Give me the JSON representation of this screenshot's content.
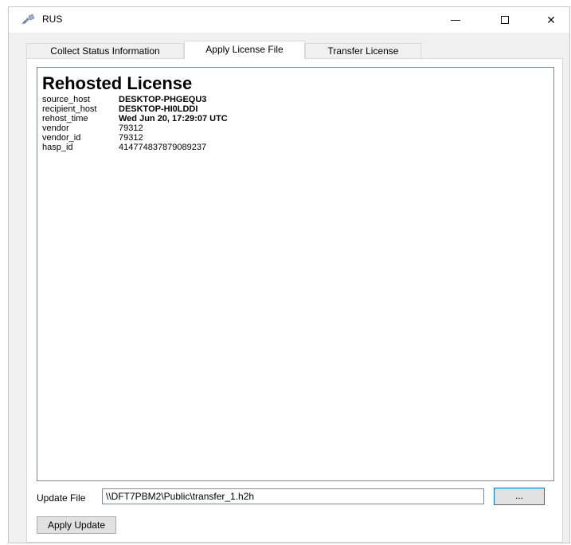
{
  "window": {
    "title": "RUS",
    "minimize_glyph": "",
    "maximize_glyph": "",
    "close_glyph": "✕"
  },
  "tabs": [
    {
      "label": "Collect Status Information",
      "active": false
    },
    {
      "label": "Apply License File",
      "active": true
    },
    {
      "label": "Transfer License",
      "active": false
    }
  ],
  "info": {
    "heading": "Rehosted License",
    "rows": [
      {
        "key": "source_host",
        "value": "DESKTOP-PHGEQU3",
        "bold": true
      },
      {
        "key": "recipient_host",
        "value": "DESKTOP-HI0LDDI",
        "bold": true
      },
      {
        "key": "rehost_time",
        "value": "Wed Jun 20, 17:29:07 UTC",
        "bold": true
      },
      {
        "key": "vendor",
        "value": "79312",
        "bold": false
      },
      {
        "key": "vendor_id",
        "value": "79312",
        "bold": false
      },
      {
        "key": "hasp_id",
        "value": "414774837879089237",
        "bold": false
      }
    ]
  },
  "update": {
    "label": "Update File",
    "value": "\\\\DFT7PBM2\\Public\\transfer_1.h2h",
    "browse_label": "...",
    "apply_label": "Apply Update"
  },
  "icons": {
    "app": "satellite-icon",
    "minimize": "minimize-icon",
    "maximize": "maximize-icon",
    "close": "close-icon"
  }
}
